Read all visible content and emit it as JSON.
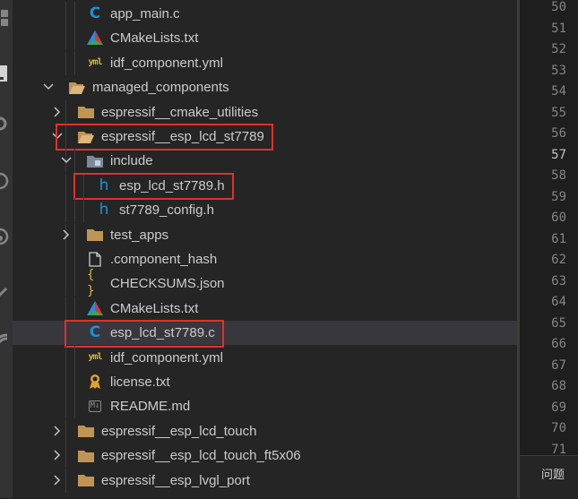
{
  "tree": {
    "items": [
      {
        "label": "app_main.c",
        "icon": "c-file-icon",
        "depth": 3,
        "chevron": "none"
      },
      {
        "label": "CMakeLists.txt",
        "icon": "cmake-icon",
        "depth": 3,
        "chevron": "none"
      },
      {
        "label": "idf_component.yml",
        "icon": "yaml-icon",
        "depth": 3,
        "chevron": "none"
      },
      {
        "label": "managed_components",
        "icon": "folder-open-icon",
        "depth": 1,
        "chevron": "down"
      },
      {
        "label": "espressif__cmake_utilities",
        "icon": "folder-icon",
        "depth": 2,
        "chevron": "right"
      },
      {
        "label": "espressif__esp_lcd_st7789",
        "icon": "folder-open-icon",
        "depth": 2,
        "chevron": "down",
        "highlighted": true
      },
      {
        "label": "include",
        "icon": "folder-include-icon",
        "depth": 3,
        "chevron": "down"
      },
      {
        "label": "esp_lcd_st7789.h",
        "icon": "h-file-icon",
        "depth": 4,
        "chevron": "none",
        "highlighted": true
      },
      {
        "label": "st7789_config.h",
        "icon": "h-file-icon",
        "depth": 4,
        "chevron": "none"
      },
      {
        "label": "test_apps",
        "icon": "folder-icon",
        "depth": 3,
        "chevron": "right"
      },
      {
        "label": ".component_hash",
        "icon": "file-icon",
        "depth": 3,
        "chevron": "none"
      },
      {
        "label": "CHECKSUMS.json",
        "icon": "json-icon",
        "depth": 3,
        "chevron": "none"
      },
      {
        "label": "CMakeLists.txt",
        "icon": "cmake-icon",
        "depth": 3,
        "chevron": "none"
      },
      {
        "label": "esp_lcd_st7789.c",
        "icon": "c-file-icon",
        "depth": 3,
        "chevron": "none",
        "selected": true,
        "highlighted": true
      },
      {
        "label": "idf_component.yml",
        "icon": "yaml-icon",
        "depth": 3,
        "chevron": "none"
      },
      {
        "label": "license.txt",
        "icon": "license-icon",
        "depth": 3,
        "chevron": "none"
      },
      {
        "label": "README.md",
        "icon": "markdown-icon",
        "depth": 3,
        "chevron": "none"
      },
      {
        "label": "espressif__esp_lcd_touch",
        "icon": "folder-icon",
        "depth": 2,
        "chevron": "right"
      },
      {
        "label": "espressif__esp_lcd_touch_ft5x06",
        "icon": "folder-icon",
        "depth": 2,
        "chevron": "right"
      },
      {
        "label": "espressif__esp_lvgl_port",
        "icon": "folder-icon",
        "depth": 2,
        "chevron": "right"
      }
    ]
  },
  "line_numbers": [
    "50",
    "51",
    "52",
    "53",
    "54",
    "55",
    "56",
    "57",
    "58",
    "59",
    "60",
    "61",
    "62",
    "63",
    "64",
    "65",
    "66",
    "67",
    "68",
    "69",
    "70",
    "71"
  ],
  "active_line": "57",
  "panel": {
    "tab_label": "问题"
  },
  "colors": {
    "highlight_box": "#e2302a",
    "selection": "#37373d",
    "c_icon": "#1f8fd8",
    "folder": "#c09553"
  }
}
